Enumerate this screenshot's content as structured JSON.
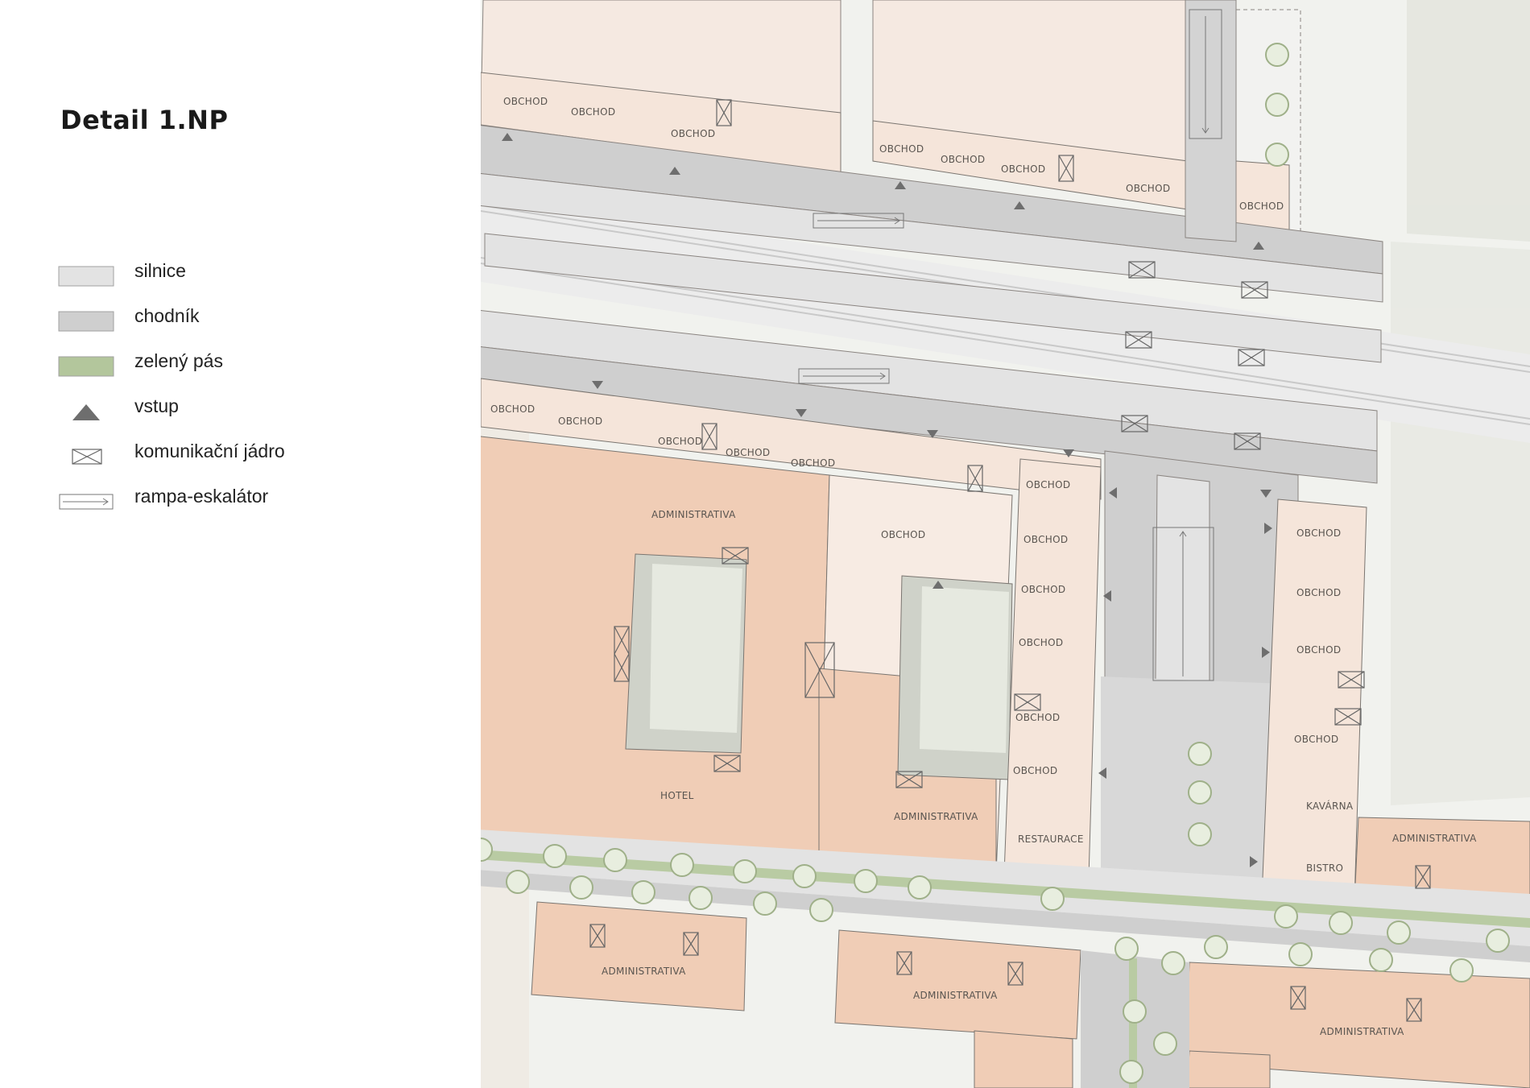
{
  "title": "Detail 1.NP",
  "legend": [
    {
      "label": "silnice",
      "symbol": "road-swatch",
      "color": "#e3e3e3"
    },
    {
      "label": "chodník",
      "symbol": "sidewalk-swatch",
      "color": "#cfcfcf"
    },
    {
      "label": "zelený pás",
      "symbol": "green-strip-swatch",
      "color": "#b3c69c"
    },
    {
      "label": "vstup",
      "symbol": "entrance-triangle-icon",
      "color": "#6e6e6e"
    },
    {
      "label": "komunikační jádro",
      "symbol": "core-cross-icon",
      "color": "#666666"
    },
    {
      "label": "rampa-eskalátor",
      "symbol": "ramp-arrow-icon",
      "color": "#666666"
    }
  ],
  "map": {
    "labels": {
      "obchod": "OBCHOD",
      "administrativa": "ADMINISTRATIVA",
      "hotel": "HOTEL",
      "restaurace": "RESTAURACE",
      "kavarna": "KAVÁRNA",
      "bistro": "BISTRO"
    },
    "colors": {
      "background": "#f1f2ee",
      "road": "#e3e3e3",
      "sidewalk": "#cfcfcf",
      "green": "#b9cba3",
      "retail": "#f5e5da",
      "office": "#f0cdb6",
      "light-block": "#f7ebe3",
      "courtyard": "#e6e9e0",
      "outline": "#7a7570"
    }
  }
}
